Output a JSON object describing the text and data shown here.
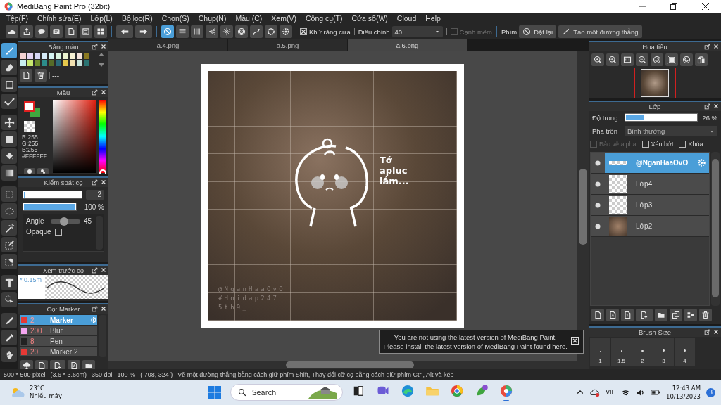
{
  "window": {
    "title": "MediBang Paint Pro (32bit)"
  },
  "menu": [
    "Tệp(F)",
    "Chỉnh sửa(E)",
    "Lớp(L)",
    "Bộ lọc(R)",
    "Chọn(S)",
    "Chụp(N)",
    "Màu (C)",
    "Xem(V)",
    "Công cụ(T)",
    "Cửa sổ(W)",
    "Cloud",
    "Help"
  ],
  "toolbar": {
    "snap_tools": [
      {
        "selected": true
      },
      {
        "selected": false
      },
      {
        "selected": false
      },
      {
        "selected": false
      },
      {
        "selected": false
      },
      {
        "selected": false
      },
      {
        "selected": false
      },
      {
        "selected": false
      },
      {
        "selected": false
      }
    ],
    "antialias": {
      "label": "Khử răng cưa",
      "checked": true
    },
    "adjust": {
      "label": "Điều chỉnh",
      "value": "40"
    },
    "soft_edge": {
      "label": "Cạnh mềm",
      "checked": false,
      "disabled": true
    },
    "keys_label": "Phím",
    "buttons": [
      "Đặt lại",
      "Tạo một đường thẳng"
    ]
  },
  "toolbox": [
    {
      "selected": true
    },
    {
      "selected": false
    },
    {
      "selected": false
    },
    {
      "selected": false
    },
    {
      "selected": false
    },
    {
      "selected": false
    },
    {
      "selected": false
    },
    {
      "selected": false
    },
    {
      "selected": false
    },
    {
      "selected": false
    },
    {
      "selected": false
    },
    {
      "selected": false
    },
    {
      "selected": false
    },
    {
      "selected": false
    },
    {
      "selected": false
    },
    {
      "selected": false
    },
    {
      "selected": false
    },
    {
      "selected": false
    }
  ],
  "palette": {
    "title": "Bảng màu",
    "swatches": [
      {
        "color": "#f4d2d2"
      },
      {
        "color": "#e4d4f2"
      },
      {
        "color": "#d6d6f4"
      },
      {
        "color": "#d4eaf6"
      },
      {
        "color": "#d4f4f2"
      },
      {
        "color": "#d8f4e0"
      },
      {
        "color": "#ecf4d0"
      },
      {
        "color": "#f6f0d2"
      },
      {
        "color": "#f4e2da"
      },
      {
        "color": "#8a7820"
      },
      {
        "color": "#c8eef0"
      },
      {
        "color": "#c8e870"
      },
      {
        "color": "#6e8c2c"
      },
      {
        "color": "#2c8c8a"
      },
      {
        "color": "#566c28"
      },
      {
        "color": "#2a6a78"
      },
      {
        "color": "#e4c84c"
      },
      {
        "color": "#f0e0b0"
      },
      {
        "color": "#c8e4dc"
      },
      {
        "color": "#2a7472"
      }
    ],
    "separator_text": "---"
  },
  "color": {
    "title": "Màu",
    "hue_slider": {
      "level": 0
    },
    "readout": [
      "R:255",
      "G:255",
      "B:255",
      "#FFFFFF"
    ]
  },
  "brush_control": {
    "title": "Kiểm soát cọ",
    "size": {
      "level": 0.03,
      "value": "2"
    },
    "opacity": {
      "level": 1,
      "reading": "100 %"
    },
    "params": [
      {
        "kind": "slider",
        "label": "Angle",
        "level": 0.45,
        "reading": "45"
      },
      {
        "kind": "checkbox",
        "label": "Opaque",
        "checked": false
      }
    ]
  },
  "brush_preview": {
    "title": "Xem trước cọ",
    "size_text": "* 0.15m"
  },
  "brushes": {
    "title": "Cọ: Marker",
    "items": [
      {
        "color": "#e53935",
        "size": "2",
        "name": "Marker",
        "selected": true
      },
      {
        "color": "#f4a6f0",
        "size": "200",
        "name": "Blur",
        "selected": false
      },
      {
        "color": "#222222",
        "size": "8",
        "name": "Pen",
        "selected": false
      },
      {
        "color": "#e53935",
        "size": "20",
        "name": "Marker 2",
        "selected": false
      }
    ]
  },
  "document_tabs": [
    {
      "label": "a.4.png",
      "selected": false
    },
    {
      "label": "a.5.png",
      "selected": false
    },
    {
      "label": "a.6.png",
      "selected": true
    }
  ],
  "canvas": {
    "handwriting": "Tớ apluc lắm...",
    "watermark": [
      "@NganHaaOvO",
      "#Hoidap247",
      "5th9_"
    ]
  },
  "notification": {
    "lines": [
      "You are not using the latest version of MediBang Paint.",
      "Please install the latest version of MediBang Paint found here."
    ]
  },
  "navigator": {
    "title": "Hoa tiêu"
  },
  "layers": {
    "title": "Lớp",
    "opacity": {
      "label": "Độ trong",
      "level": 0.26,
      "reading": "26 %"
    },
    "blend": {
      "label": "Pha trộn",
      "value": "Bình thường"
    },
    "options": [
      {
        "label": "Bảo vệ alpha",
        "checked": false,
        "disabled": true
      },
      {
        "label": "Xén bớt",
        "checked": false,
        "disabled": false
      },
      {
        "label": "Khóa",
        "checked": false,
        "disabled": false
      }
    ],
    "items": [
      {
        "name": "@NganHaaOvO",
        "kind": "text",
        "selected": true
      },
      {
        "name": "Lớp4",
        "kind": "empty",
        "selected": false
      },
      {
        "name": "Lớp3",
        "kind": "empty",
        "selected": false
      },
      {
        "name": "Lớp2",
        "kind": "photo",
        "selected": false
      }
    ]
  },
  "brush_size": {
    "title": "Brush Size",
    "sizes": [
      "1",
      "1.5",
      "2",
      "3",
      "4"
    ]
  },
  "status_bar": [
    "500 * 500 pixel",
    "(3.6 * 3.6cm)",
    "350 dpi",
    "100 %",
    "( 708, 324 )",
    "Vẽ một đường thẳng bằng cách giữ phím Shift, Thay đổi cỡ cọ bằng cách giữ phím Ctrl, Alt và kéo"
  ],
  "taskbar": {
    "weather": {
      "temperature": "23°C",
      "condition": "Nhiều mây"
    },
    "search": {
      "label": "Search"
    },
    "apps": [
      {
        "active": false
      },
      {
        "active": false
      },
      {
        "active": false
      },
      {
        "active": false
      },
      {
        "active": false
      },
      {
        "active": false
      },
      {
        "active": true
      }
    ],
    "language": "VIE",
    "time": "12:43 AM",
    "date": "10/13/2023",
    "notifications": "3"
  }
}
